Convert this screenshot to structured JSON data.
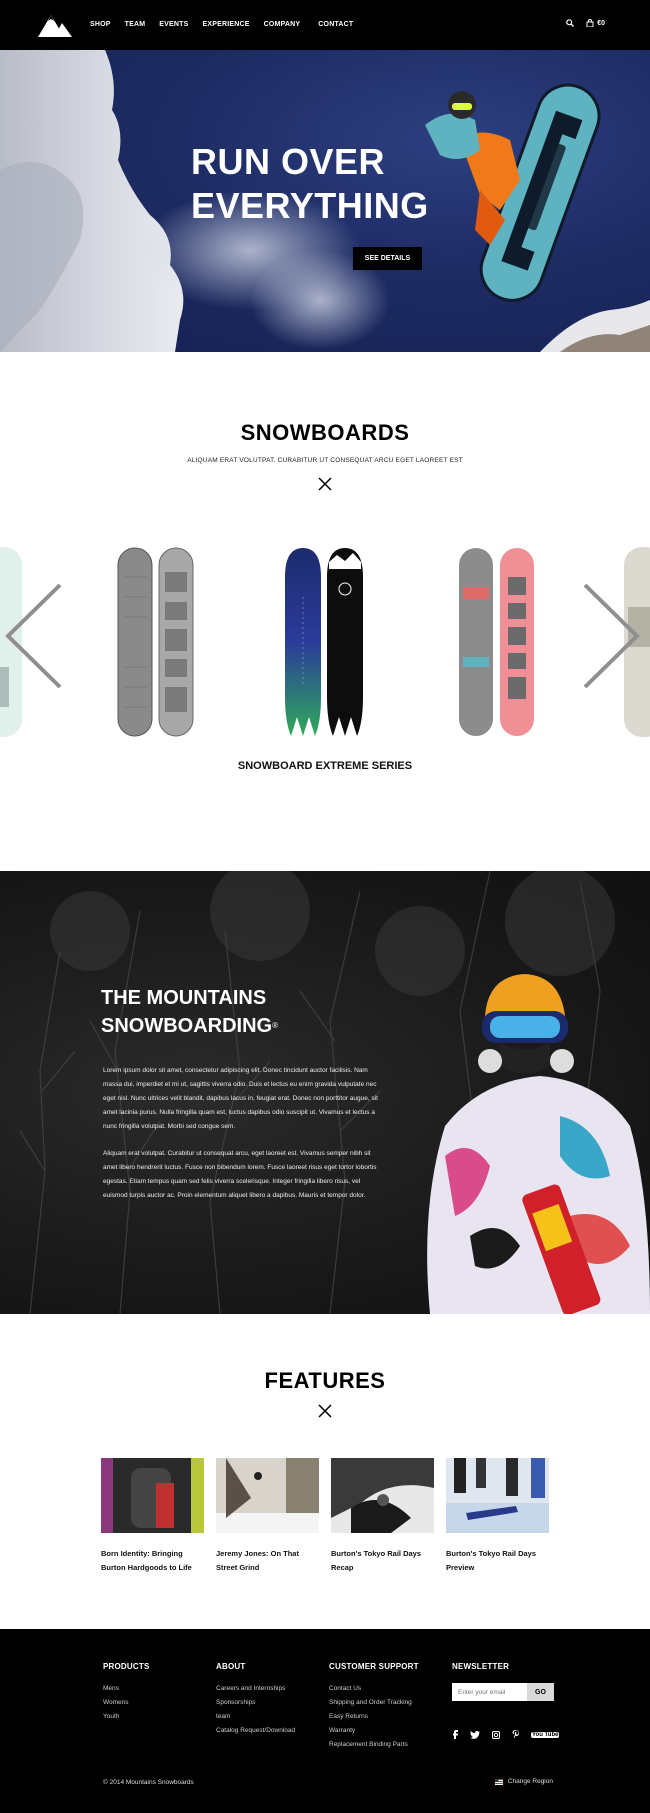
{
  "header": {
    "nav": [
      "SHOP",
      "TEAM",
      "EVENTS",
      "EXPERIENCE",
      "COMPANY",
      "CONTACT"
    ],
    "cart_total": "€0"
  },
  "hero": {
    "title_line1": "RUN OVER",
    "title_line2": "EVERYTHING",
    "button": "SEE DETAILS"
  },
  "snowboards": {
    "title": "SNOWBOARDS",
    "subtitle": "ALIQUAM ERAT VOLUTPAT. CURABITUR UT CONSEQUAT ARCU EGET LAOREET EST",
    "series_title": "SNOWBOARD EXTREME SERIES"
  },
  "mountains": {
    "title_line1": "THE MOUNTAINS",
    "title_line2": "SNOWBOARDING",
    "trademark": "®",
    "paragraph1": "Lorem ipsum dolor sit amet, consectetur adipiscing elit. Donec tincidunt auctor facilisis. Nam massa dui, imperdiet et mi ut, sagittis viverra odio. Duis et lectus eu enim gravida vulputate nec eget nisl. Nunc ultrices velit blandit, dapibus lacus in, feugiat erat. Donec non porttitor augue, sit amet lacinia purus. Nulla fringilla quam est, luctus dapibus odio suscipit ut. Vivamus et lectus a nunc fringilla volutpat. Morbi sed congue sem.",
    "paragraph2": "Aliquam erat volutpat. Curabitur ut consequat arcu, eget laoreet est. Vivamus semper nibh sit amet libero hendrerit luctus. Fusce non bibendum lorem. Fusce laoreet risus eget tortor lobortis egestas. Etiam tempus quam sed felis viverra scelerisque. Integer fringilla libero risus, vel euismod turpis auctor ac. Proin elementum aliquet libero a dapibus. Mauris et tempor dolor."
  },
  "features": {
    "title": "FEATURES",
    "items": [
      {
        "caption": "Born Identity: Bringing Burton Hardgoods to Life"
      },
      {
        "caption": "Jeremy Jones: On That Street Grind"
      },
      {
        "caption": "Burton's Tokyo Rail Days Recap"
      },
      {
        "caption": "Burton's Tokyo Rail Days Preview"
      }
    ]
  },
  "footer": {
    "columns": [
      {
        "title": "PRODUCTS",
        "links": [
          "Mens",
          "Womens",
          "Youth"
        ]
      },
      {
        "title": "ABOUT",
        "links": [
          "Careers and Internships",
          "Sponsorships",
          "team",
          "Catalog Request/Download"
        ]
      },
      {
        "title": "CUSTOMER SUPPORT",
        "links": [
          "Contact Us",
          "Shipping and Order Tracking",
          "Easy Returns",
          "Warranty",
          "Replacement Binding Parts"
        ]
      }
    ],
    "newsletter_title": "NEWSLETTER",
    "newsletter_placeholder": "Enter your email",
    "newsletter_button": "GO",
    "social": [
      "facebook-icon",
      "twitter-icon",
      "instagram-icon",
      "pinterest-icon",
      "youtube-icon"
    ],
    "youtube_label": "You Tube",
    "copyright": "© 2014 Mountains Snowboards",
    "change_region": "Change Region"
  },
  "colors": {
    "header_bg": "#000000",
    "hero_sky": "#1d2b63",
    "board_blue": "#5fb3c0",
    "orange": "#f07a1a"
  }
}
